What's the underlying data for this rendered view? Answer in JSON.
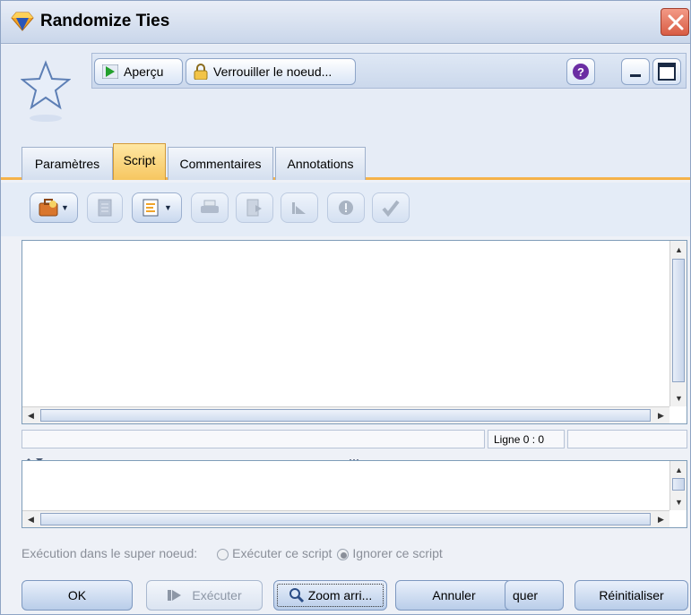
{
  "window": {
    "title": "Randomize Ties",
    "node_icon": "randomize-node-icon",
    "close_icon": "close-icon"
  },
  "header": {
    "preview_label": "Aperçu",
    "lock_label": "Verrouiller le noeud...",
    "help_icon": "help-icon",
    "minimize_icon": "minimize-icon",
    "maximize_icon": "maximize-icon"
  },
  "tabs": [
    {
      "label": "Paramètres",
      "active": false
    },
    {
      "label": "Script",
      "active": true
    },
    {
      "label": "Commentaires",
      "active": false
    },
    {
      "label": "Annotations",
      "active": false
    }
  ],
  "script_toolbar": [
    {
      "icon": "briefcase-icon",
      "dropdown": true,
      "enabled": true
    },
    {
      "icon": "document-icon",
      "dropdown": false,
      "enabled": false
    },
    {
      "icon": "script-file-icon",
      "dropdown": true,
      "enabled": true
    },
    {
      "icon": "print-icon",
      "dropdown": false,
      "enabled": false
    },
    {
      "icon": "run-selected-icon",
      "dropdown": false,
      "enabled": false
    },
    {
      "icon": "run-line-icon",
      "dropdown": false,
      "enabled": false
    },
    {
      "icon": "stop-icon",
      "dropdown": false,
      "enabled": false
    },
    {
      "icon": "check-syntax-icon",
      "dropdown": false,
      "enabled": false
    }
  ],
  "editor": {
    "content": ""
  },
  "status": {
    "line_label": "Ligne 0 : 0"
  },
  "execution": {
    "label": "Exécution dans le super noeud:",
    "option_run": "Exécuter ce script",
    "option_ignore": "Ignorer ce script",
    "selected": "ignore"
  },
  "buttons": {
    "ok": "OK",
    "execute": "Exécuter",
    "zoom": "Zoom arri...",
    "cancel": "Annuler",
    "apply_partial": "quer",
    "reset": "Réinitialiser"
  },
  "colors": {
    "accent": "#f5b24a",
    "frame": "#8fa4c4"
  }
}
